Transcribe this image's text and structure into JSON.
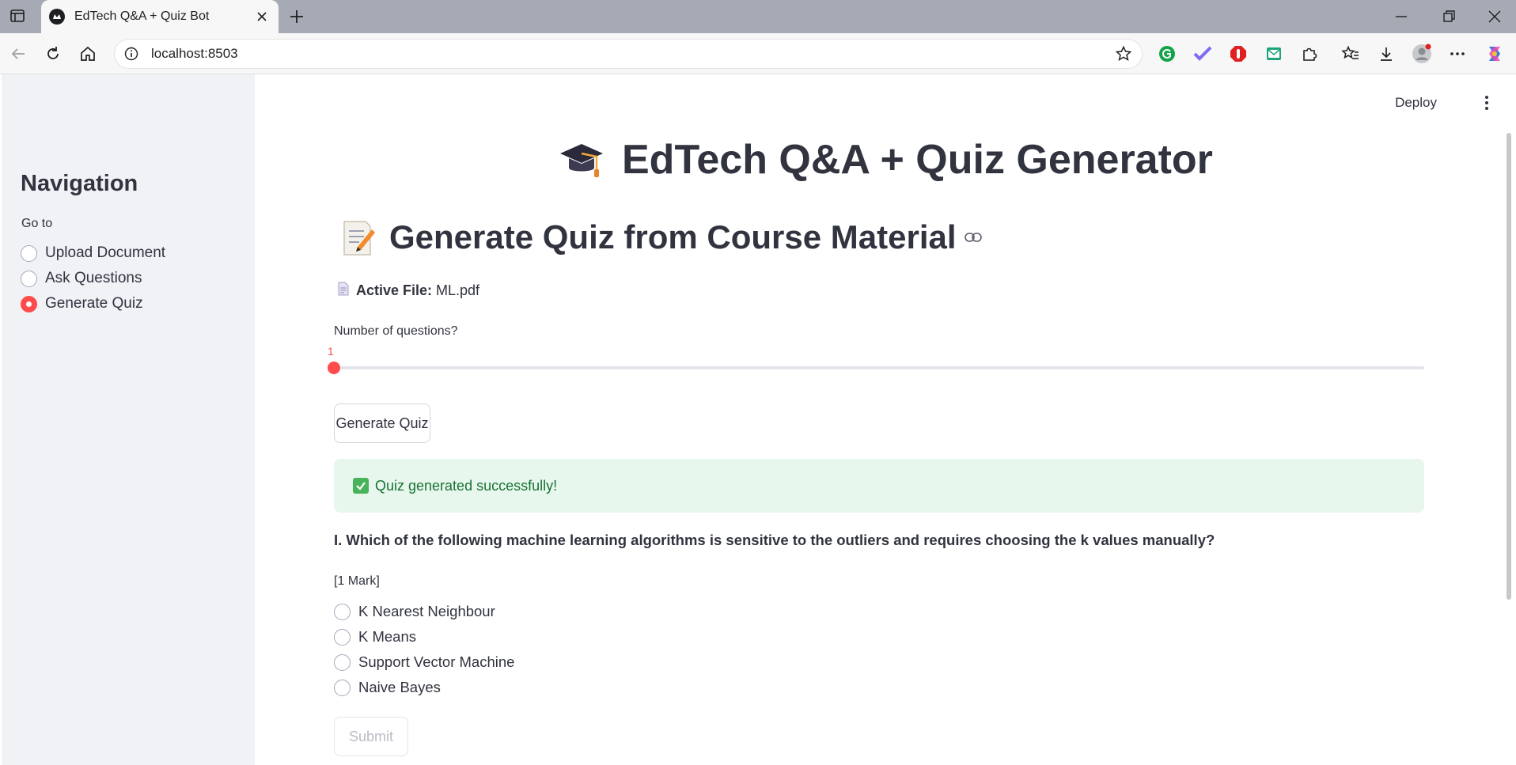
{
  "browser": {
    "tab_title": "EdTech Q&A + Quiz Bot",
    "address": "localhost:8503"
  },
  "sidebar": {
    "title": "Navigation",
    "goto_label": "Go to",
    "options": [
      {
        "label": "Upload Document",
        "selected": false
      },
      {
        "label": "Ask Questions",
        "selected": false
      },
      {
        "label": "Generate Quiz",
        "selected": true
      }
    ]
  },
  "header": {
    "deploy_label": "Deploy"
  },
  "main": {
    "title": "EdTech Q&A + Quiz Generator",
    "subtitle": "Generate Quiz from Course Material",
    "active_file_label": "Active File:",
    "active_file_name": "ML.pdf",
    "slider": {
      "label": "Number of questions?",
      "value": "1"
    },
    "generate_button": "Generate Quiz",
    "success_message": "Quiz generated successfully!",
    "question": "I. Which of the following machine learning algorithms is sensitive to the outliers and requires choosing the k values manually?",
    "marks": "[1 Mark]",
    "options": [
      "K Nearest Neighbour",
      "K Means",
      "Support Vector Machine",
      "Naive Bayes"
    ],
    "submit_button": "Submit"
  },
  "colors": {
    "accent": "#ff4b4b",
    "sidebar_bg": "#f0f2f6",
    "success_bg": "#e8f7ed",
    "success_text": "#177233"
  }
}
